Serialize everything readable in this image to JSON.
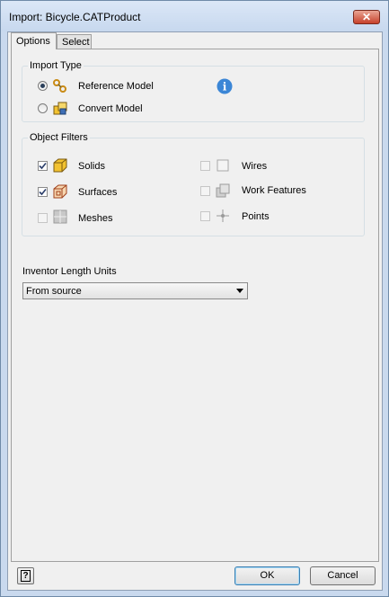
{
  "window": {
    "title": "Import:  Bicycle.CATProduct",
    "close_glyph": "✕"
  },
  "tabs": [
    {
      "label": "Options",
      "active": true
    },
    {
      "label": "Select",
      "active": false
    }
  ],
  "import_type": {
    "label": "Import Type",
    "options": [
      {
        "label": "Reference Model",
        "selected": true,
        "icon": "reference-model-icon"
      },
      {
        "label": "Convert Model",
        "selected": false,
        "icon": "convert-model-icon"
      }
    ],
    "info_icon": "info-icon",
    "info_glyph": "i"
  },
  "object_filters": {
    "label": "Object Filters",
    "items": [
      {
        "label": "Solids",
        "checked": true,
        "enabled": true,
        "icon": "solid-cube-icon"
      },
      {
        "label": "Surfaces",
        "checked": true,
        "enabled": true,
        "icon": "surface-cube-icon"
      },
      {
        "label": "Meshes",
        "checked": false,
        "enabled": false,
        "icon": "mesh-icon"
      },
      {
        "label": "Wires",
        "checked": false,
        "enabled": false,
        "icon": "wire-icon"
      },
      {
        "label": "Work Features",
        "checked": false,
        "enabled": false,
        "icon": "work-features-icon"
      },
      {
        "label": "Points",
        "checked": false,
        "enabled": false,
        "icon": "point-icon"
      }
    ]
  },
  "units": {
    "label": "Inventor Length Units",
    "value": "From source"
  },
  "footer": {
    "help_glyph": "?",
    "ok_label": "OK",
    "cancel_label": "Cancel"
  },
  "colors": {
    "accent": "#3c7fb1",
    "solid_yellow": "#f2c230",
    "info_blue": "#3b86d6"
  }
}
